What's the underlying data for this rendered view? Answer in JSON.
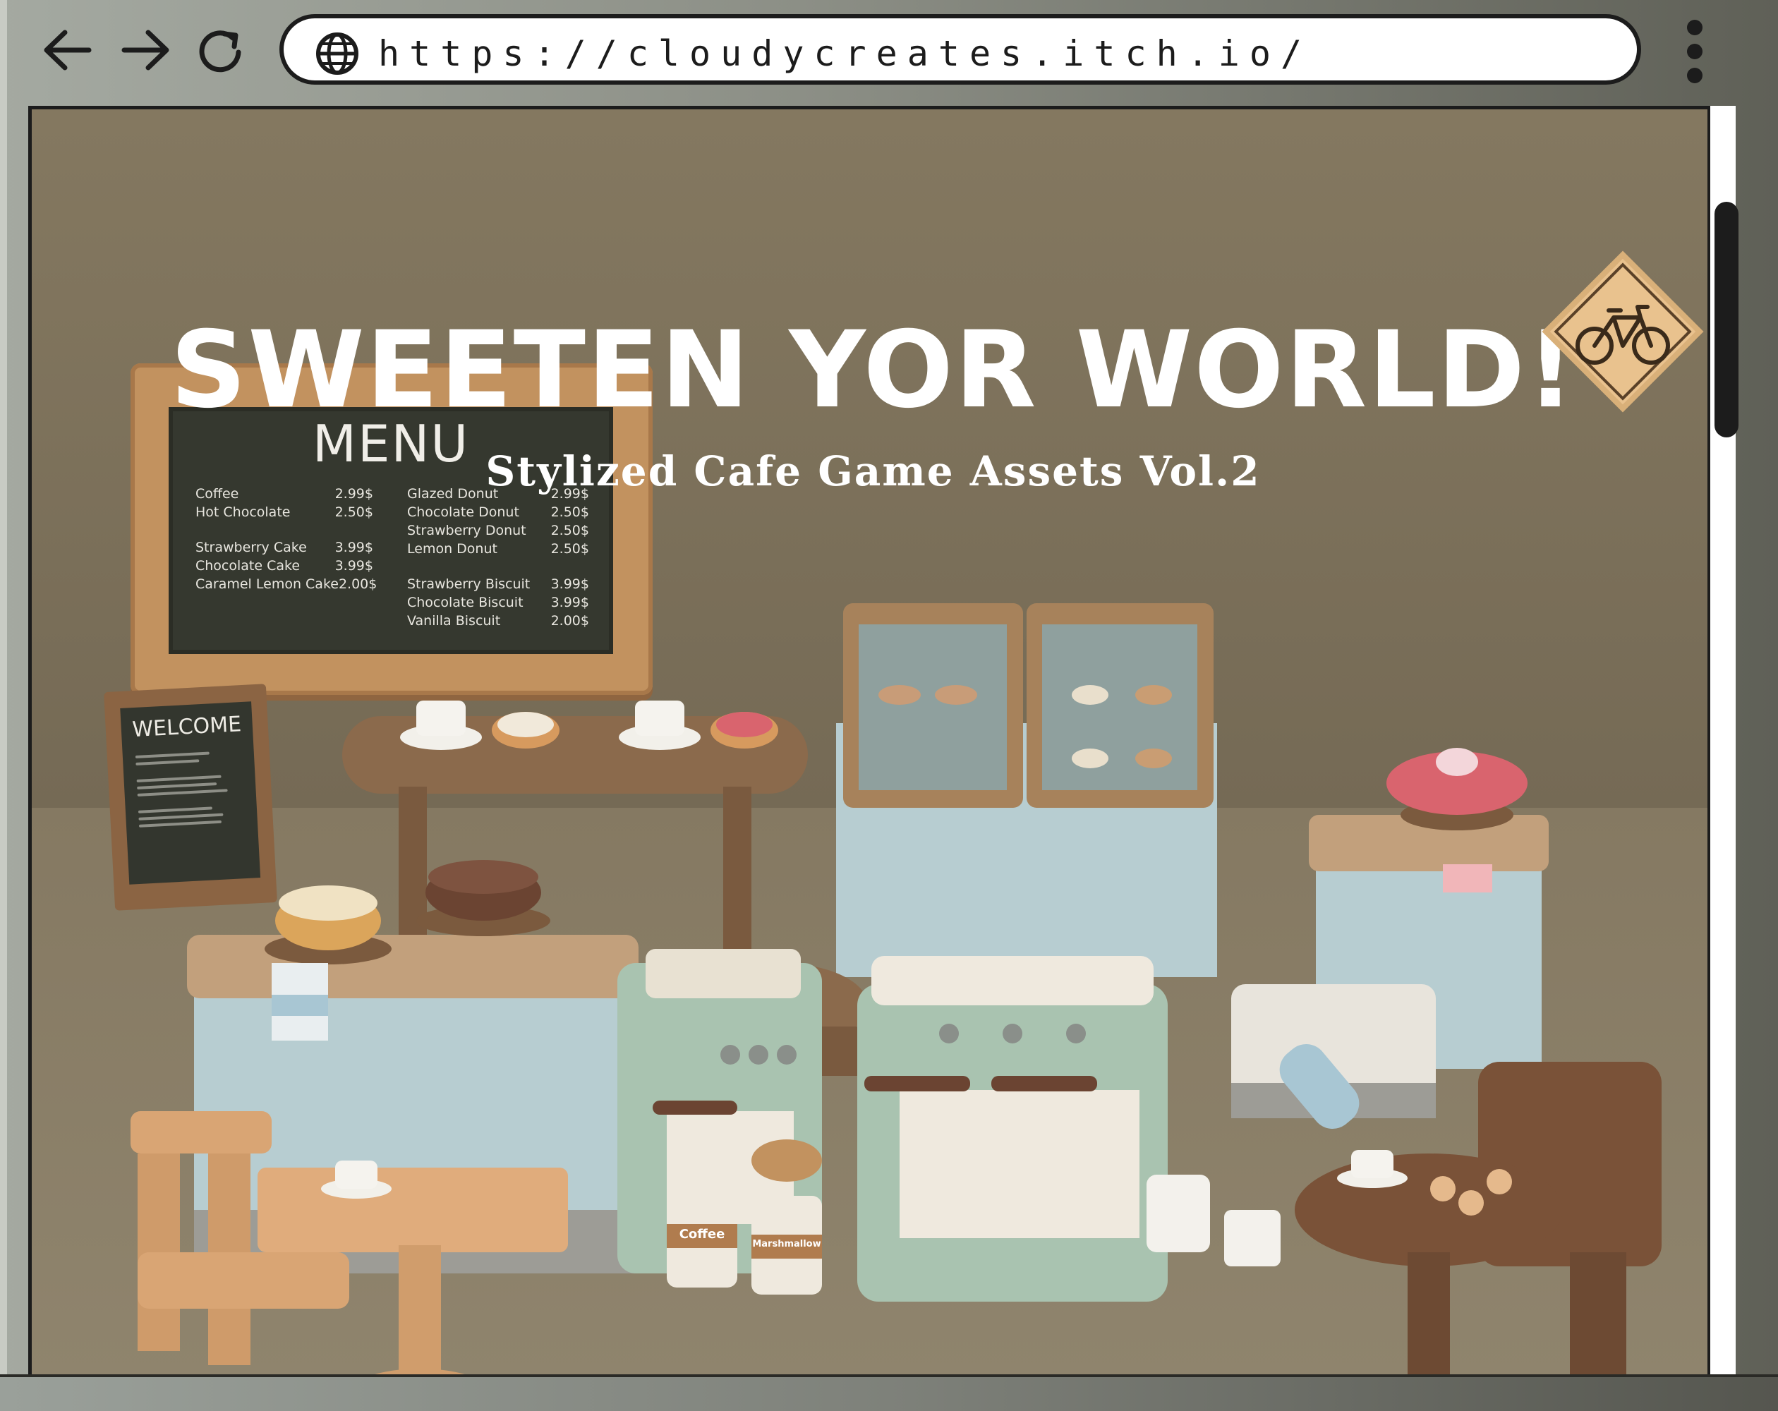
{
  "browser": {
    "url": "https://cloudycreates.itch.io/",
    "nav": {
      "back_icon": "arrow-left-icon",
      "forward_icon": "arrow-right-icon",
      "reload_icon": "reload-icon"
    },
    "site_icon": "globe-icon",
    "menu_icon": "kebab-menu-icon"
  },
  "hero": {
    "title": "SWEETEN YOR WORLD!",
    "subtitle": "Stylized Cafe Game Assets Vol.2",
    "sign_icon": "bicycle-icon"
  },
  "menu_board": {
    "title": "MENU",
    "left_items": [
      {
        "name": "Coffee",
        "price": "2.99$"
      },
      {
        "name": "Hot Chocolate",
        "price": "2.50$"
      },
      {
        "name": "Strawberry Cake",
        "price": "3.99$"
      },
      {
        "name": "Chocolate Cake",
        "price": "3.99$"
      },
      {
        "name": "Caramel Lemon Cake",
        "price": "2.00$"
      }
    ],
    "right_items": [
      {
        "name": "Glazed Donut",
        "price": "2.99$"
      },
      {
        "name": "Chocolate Donut",
        "price": "2.50$"
      },
      {
        "name": "Strawberry Donut",
        "price": "2.50$"
      },
      {
        "name": "Lemon Donut",
        "price": "2.50$"
      },
      {
        "name": "Strawberry Biscuit",
        "price": "3.99$"
      },
      {
        "name": "Chocolate Biscuit",
        "price": "3.99$"
      },
      {
        "name": "Vanilla Biscuit",
        "price": "2.00$"
      }
    ]
  },
  "welcome_sign": {
    "title": "WELCOME"
  },
  "jars": {
    "coffee": "Coffee",
    "marshmallow": "Marshmallow"
  },
  "colors": {
    "scene_bg": "#8a7c65",
    "floor": "#8c8068",
    "wood_light": "#d9a574",
    "wood_dark": "#7a5238",
    "counter_blue": "#b7cdd1",
    "machine_green": "#a9c3b0",
    "cake_pink": "#d9646e"
  }
}
